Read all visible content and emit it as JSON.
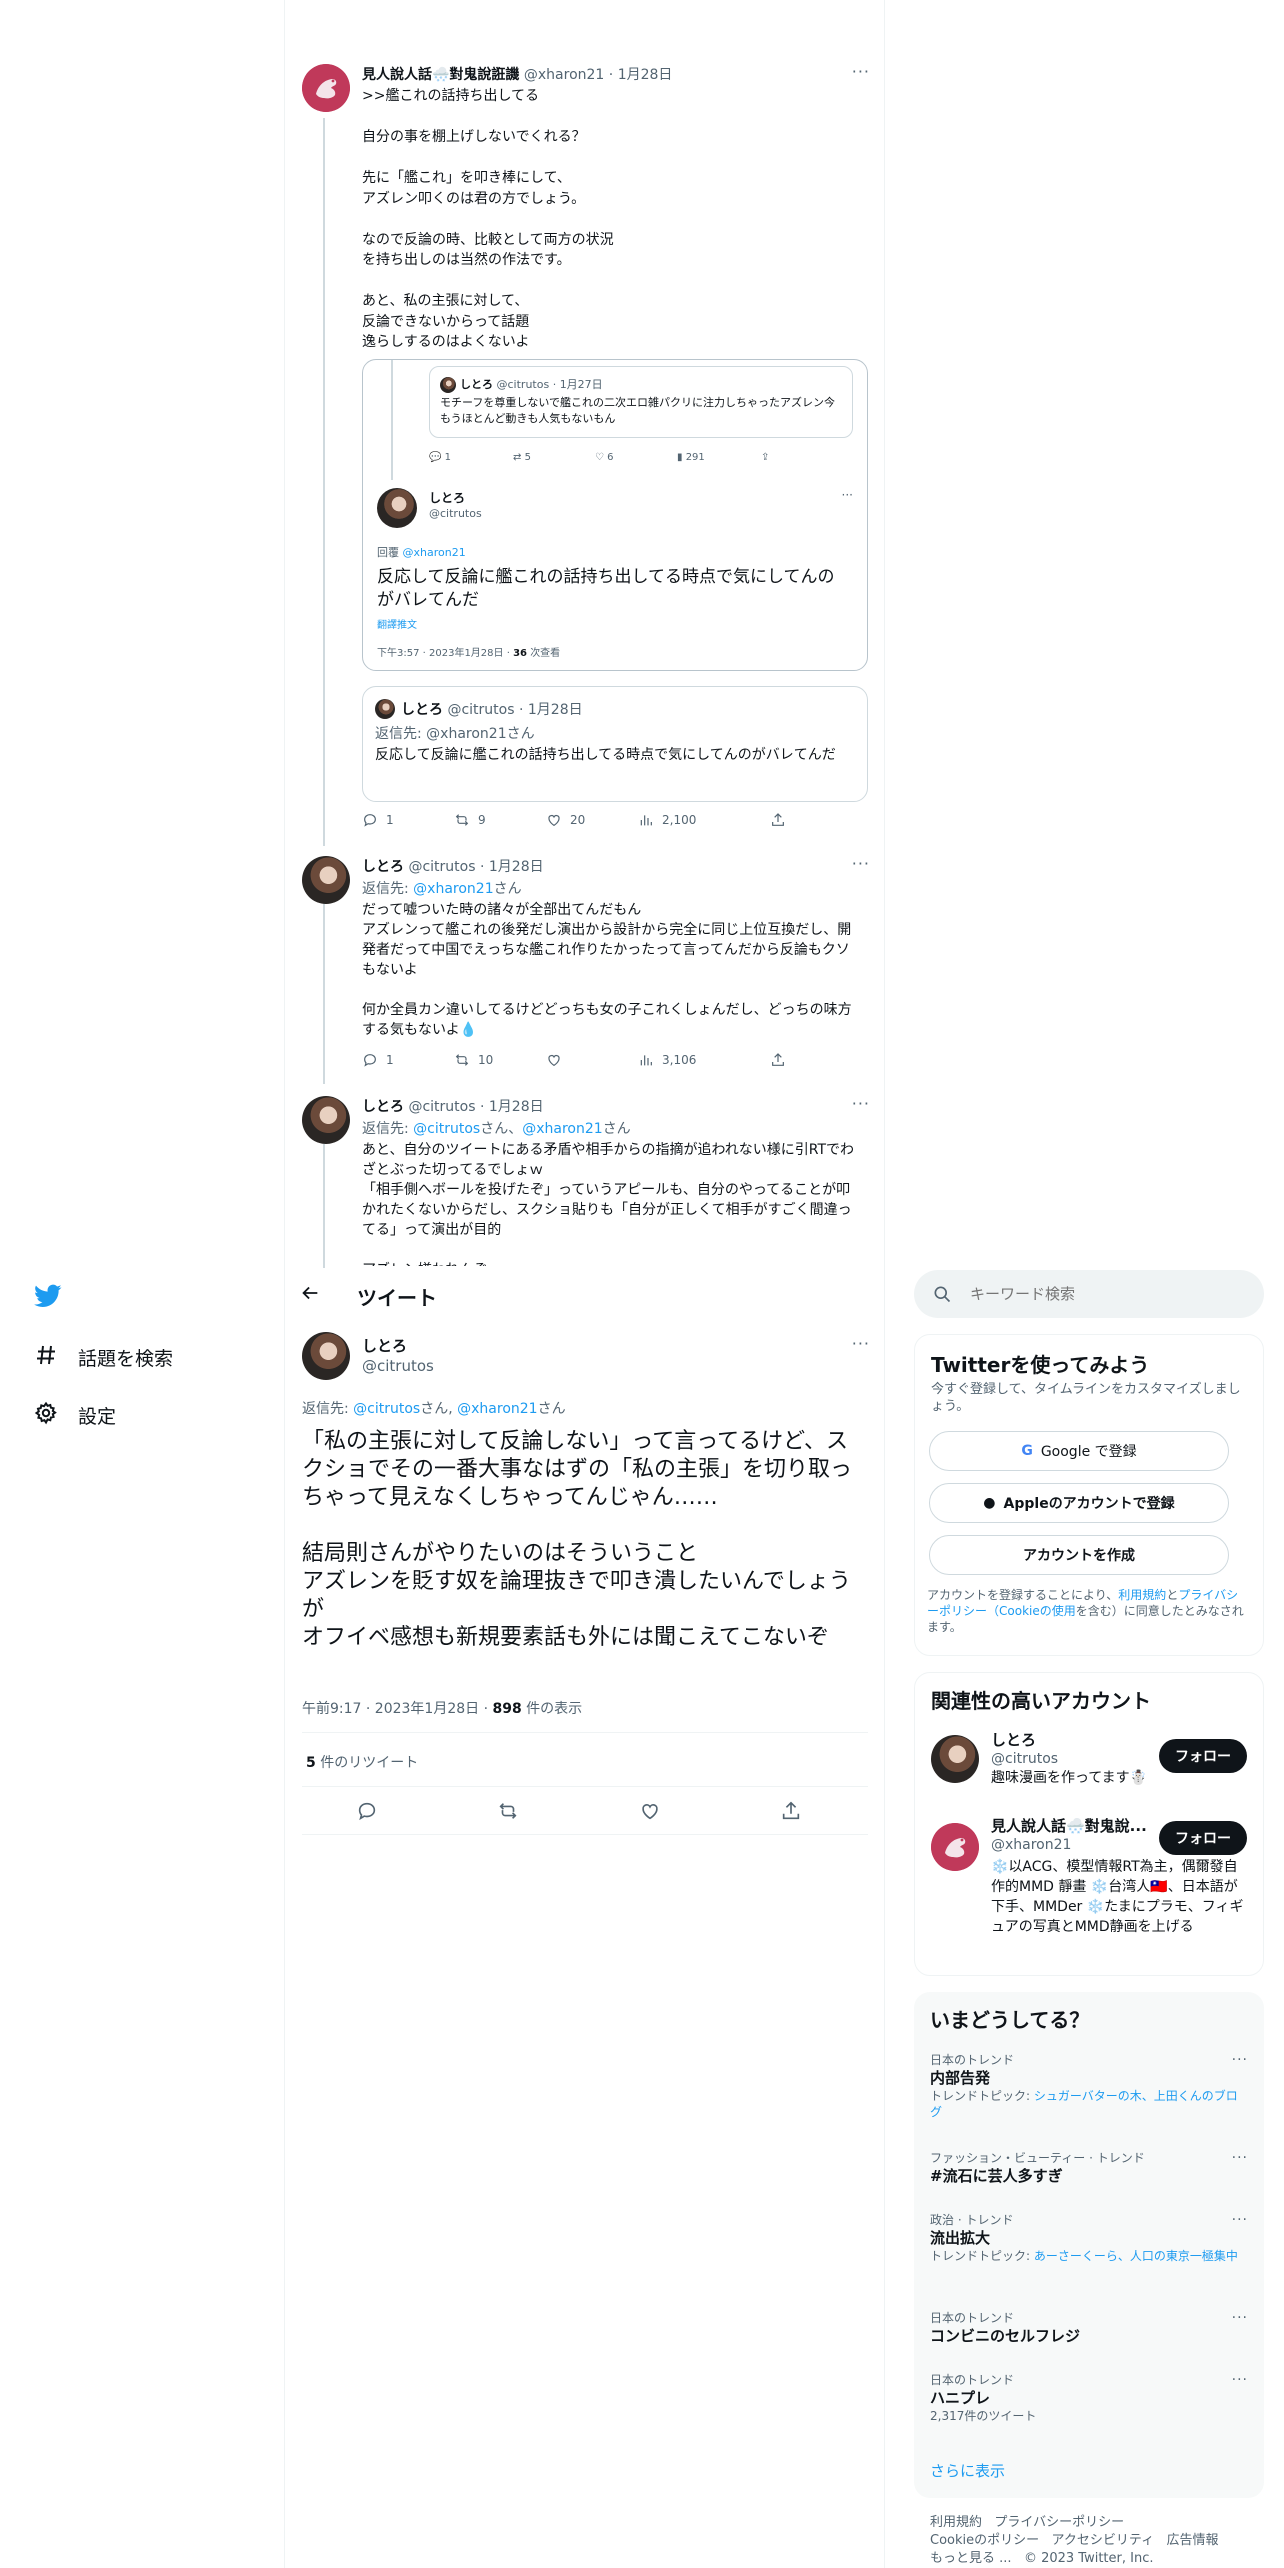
{
  "sidebar": {
    "items": [
      {
        "label": "話題を検索",
        "icon": "hashtag-icon"
      },
      {
        "label": "設定",
        "icon": "gear-icon"
      }
    ]
  },
  "header": {
    "title": "ツイート"
  },
  "search": {
    "placeholder": "キーワード検索"
  },
  "thread": {
    "tweet1": {
      "name": "見人說人話🌨️對鬼說誑譏",
      "handle": "@xharon21",
      "date": "1月28日",
      "text": ">>艦これの話持ち出してる\n\n自分の事を棚上げしないでくれる？\n\n先に「艦これ」を叩き棒にして、\nアズレン叩くのは君の方でしょう。\n\nなので反論の時、比較として両方の状況\nを持ち出しのは当然の作法です。\n\nあと、私の主張に対して、\n反論できないからって話題\n逸らしするのはよくないよ",
      "screenshot": {
        "inner_name": "しとろ",
        "inner_handle": "@citrutos",
        "inner_date": "1月27日",
        "inner_text": "モチーフを尊重しないで艦これの二次エロ雑パクリに注力しちゃったアズレン今もうほとんど動きも人気もないもん",
        "inner_reply": "1",
        "inner_retweet": "5",
        "inner_like": "6",
        "inner_views": "291",
        "name": "しとろ",
        "handle": "@citrutos",
        "reply_to_label": "回覆",
        "reply_to": "@xharon21",
        "text": "反応して反論に艦これの話持ち出してる時点で気にしてんのがバレてんだ",
        "translate": "翻譯推文",
        "meta": "下午3:57 · 2023年1月28日 · ",
        "views_num": "36",
        "views_label": "次查看"
      },
      "quote": {
        "name": "しとろ",
        "handle": "@citrutos",
        "date": "1月28日",
        "reply_prefix": "返信先: ",
        "reply_to": "@xharon21さん",
        "text": "反応して反論に艦これの話持ち出してる時点で気にしてんのがバレてんだ"
      },
      "stats": {
        "reply": "1",
        "retweet": "9",
        "like": "20",
        "views": "2,100"
      }
    },
    "tweet2": {
      "name": "しとろ",
      "handle": "@citrutos",
      "date": "1月28日",
      "reply_prefix": "返信先: ",
      "reply_to": "@xharon21",
      "reply_suffix": "さん",
      "text": "だって嘘ついた時の諸々が全部出てんだもん\nアズレンって艦これの後発だし演出から設計から完全に同じ上位互換だし、開発者だって中国でえっちな艦これ作りたかったって言ってんだから反論もクソもないよ\n\n何か全員カン違いしてるけどどっちも女の子これくしょんだし、どっちの味方する気もないよ💧",
      "stats": {
        "reply": "1",
        "retweet": "10",
        "like": "",
        "views": "3,106"
      }
    },
    "tweet3": {
      "name": "しとろ",
      "handle": "@citrutos",
      "date": "1月28日",
      "reply_prefix": "返信先: ",
      "reply_to_a": "@citrutos",
      "reply_mid": "さん、",
      "reply_to_b": "@xharon21",
      "reply_suffix": "さん",
      "text": "あと、自分のツイートにある矛盾や相手からの指摘が追われない様に引RTでわざとぶった切ってるでしょｗ\n「相手側へボールを投げたぞ」っていうアピールも、自分のやってることが叩かれたくないからだし、スクショ貼りも「自分が正しくて相手がすごく間違ってる」って演出が目的\n\nアズレン嫌われんぞ"
    }
  },
  "main_tweet": {
    "name": "しとろ",
    "handle": "@citrutos",
    "reply_prefix": "返信先: ",
    "reply_to_a": "@citrutos",
    "reply_mid": "さん, ",
    "reply_to_b": "@xharon21",
    "reply_suffix": "さん",
    "text": "「私の主張に対して反論しない」って言ってるけど、スクショでその一番大事なはずの「私の主張」を切り取っちゃって見えなくしちゃってんじゃん……\n\n結局則さんがやりたいのはそういうこと\nアズレンを貶す奴を論理抜きで叩き潰したいんでしょうが\nオフイベ感想も新規要素話も外には聞こえてこないぞ",
    "time": "午前9:17 · 2023年1月28日 · ",
    "views_num": "898",
    "views_label": " 件の表示",
    "retweets_num": "5",
    "retweets_label": " 件のリツイート"
  },
  "signup": {
    "title": "Twitterを使ってみよう",
    "subtitle": "今すぐ登録して、タイムラインをカスタマイズしましょう。",
    "google": "Google で登録",
    "apple": "Appleのアカウントで登録",
    "create": "アカウントを作成",
    "terms_a": "アカウントを登録することにより、",
    "terms_link1": "利用規約",
    "terms_b": "と",
    "terms_link2": "プライバシーポリシー（Cookieの使用",
    "terms_c": "を含む）に同意したとみなされます。"
  },
  "related": {
    "title": "関連性の高いアカウント",
    "follow": "フォロー",
    "accounts": [
      {
        "name": "しとろ",
        "handle": "@citrutos",
        "bio": "趣味漫画を作ってます☃️"
      },
      {
        "name": "見人說人話🌨️對鬼說...",
        "handle": "@xharon21",
        "bio": "❄️以ACG、模型情報RT為主，偶爾發自作的MMD 靜畫 ❄️台湾人🇹🇼、日本語が下手、MMDer ❄️たまにプラモ、フィギュアの写真とMMD静画を上げる"
      }
    ]
  },
  "trends": {
    "title": "いまどうしてる？",
    "items": [
      {
        "category": "日本のトレンド",
        "name": "内部告発",
        "sub_label": "トレンドトピック: ",
        "sub_link": "シュガーバターの木、上田くんのブログ"
      },
      {
        "category": "ファッション・ビューティー · トレンド",
        "name": "#流石に芸人多すぎ",
        "sub_label": "",
        "sub_link": ""
      },
      {
        "category": "政治 · トレンド",
        "name": "流出拡大",
        "sub_label": "トレンドトピック: ",
        "sub_link": "あーさーくーら、人口の東京一極集中"
      },
      {
        "category": "日本のトレンド",
        "name": "コンビニのセルフレジ",
        "sub_label": "",
        "sub_link": ""
      },
      {
        "category": "日本のトレンド",
        "name": "ハニプレ",
        "sub_label": "2,317件のツイート",
        "sub_link": ""
      }
    ],
    "show_more": "さらに表示"
  },
  "footer": {
    "line1a": "利用規約",
    "line1b": "プライバシーポリシー",
    "line2a": "Cookieのポリシー",
    "line2b": "アクセシビリティ",
    "line2c": "広告情報",
    "line3a": "もっと見る ...",
    "line3b": "© 2023 Twitter, Inc."
  }
}
